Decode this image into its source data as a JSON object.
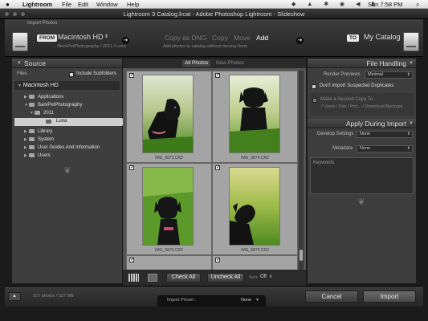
{
  "menubar": {
    "apple": "",
    "app": "Lightroom",
    "items": [
      "File",
      "Edit",
      "Window",
      "Help"
    ],
    "clock": "Sun 7:58 PM"
  },
  "window": {
    "title": "Lightroom 3 Catalog.lrcat - Adobe Photoshop Lightroom - Slideshow",
    "import_label": "Import Photos"
  },
  "header": {
    "from_badge": "FROM",
    "source_name": "Macintosh HD",
    "source_path": "... /BarkPetPhotography / 2011 / Luna",
    "modes": [
      "Copy as DNG",
      "Copy",
      "Move",
      "Add"
    ],
    "active_mode": "Add",
    "mode_desc": "Add photos to catalog without moving them",
    "to_badge": "TO",
    "dest_name": "My Catalog"
  },
  "source": {
    "title": "Source",
    "files_label": "Files",
    "include_subfolders": "Include Subfolders",
    "volume": "Macintosh HD",
    "folders": [
      {
        "label": "Applications"
      },
      {
        "label": "BarkPetPhotography"
      },
      {
        "label": "2011"
      },
      {
        "label": "Luna"
      },
      {
        "label": "Library"
      },
      {
        "label": "System"
      },
      {
        "label": "User Guides And Information"
      },
      {
        "label": "Users"
      }
    ]
  },
  "grid": {
    "tabs": [
      "All Photos",
      "New Photos"
    ],
    "active_tab": "All Photos",
    "photos": [
      {
        "name": "IMG_5873.CR2",
        "checked": true
      },
      {
        "name": "IMG_5874.CR2",
        "checked": true
      },
      {
        "name": "IMG_5875.CR2",
        "checked": true
      },
      {
        "name": "IMG_5876.CR2",
        "checked": true
      }
    ],
    "check_all": "Check All",
    "uncheck_all": "Uncheck All",
    "sort_label": "Sort:",
    "sort_value": "Off"
  },
  "file_handling": {
    "title": "File Handling",
    "render_label": "Render Previews",
    "render_value": "Minimal",
    "dont_import": "Don't Import Suspected Duplicates",
    "second_copy": "Make a Second Copy To :",
    "second_copy_path": "/ Users / Kim / Pict... / Download Backups"
  },
  "apply": {
    "title": "Apply During Import",
    "develop_label": "Develop Settings",
    "develop_value": "None",
    "metadata_label": "Metadata",
    "metadata_value": "None",
    "keywords_label": "Keywords"
  },
  "footer": {
    "count": "107 photos / 527 MB",
    "preset_label": "Import Preset :",
    "preset_value": "None",
    "cancel": "Cancel",
    "import": "Import"
  }
}
